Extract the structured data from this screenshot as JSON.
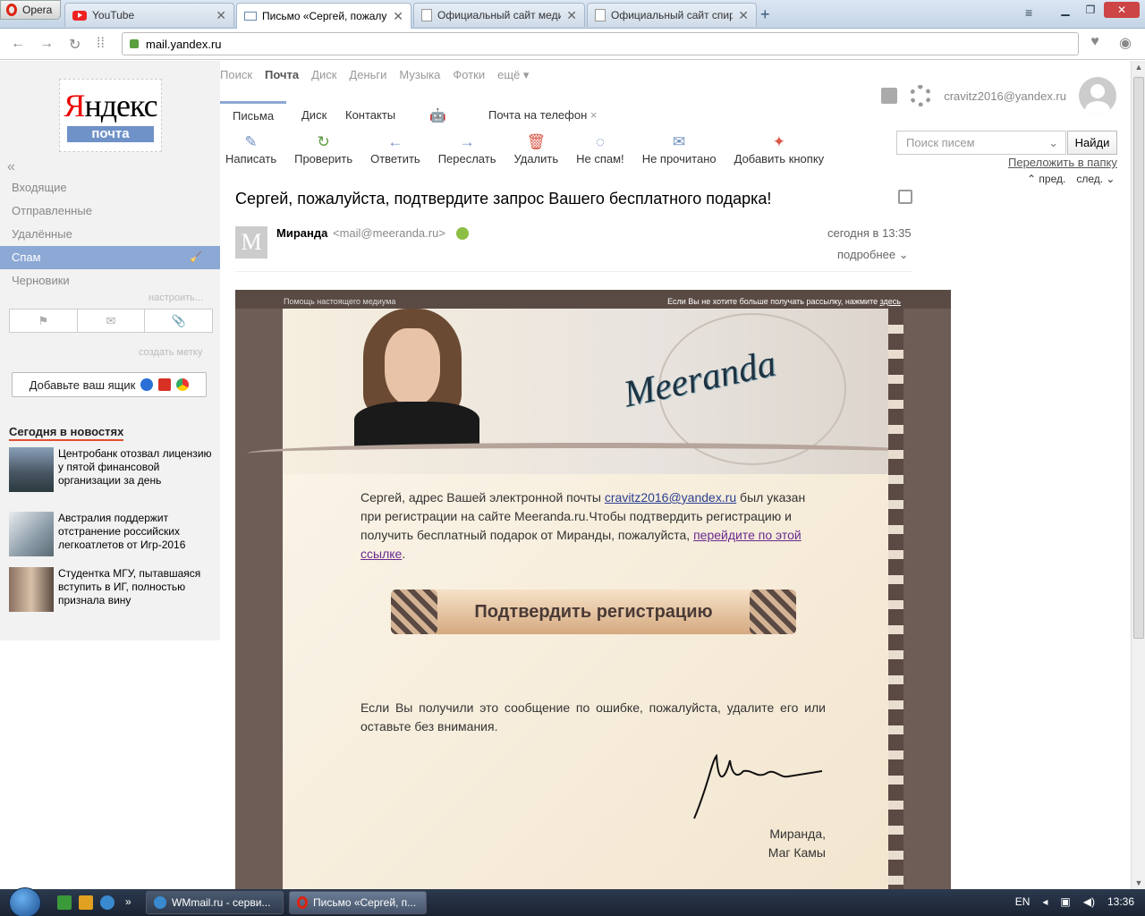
{
  "browser": {
    "menu_label": "Opera",
    "tabs": [
      {
        "title": "YouTube"
      },
      {
        "title": "Письмо «Сергей, пожалу"
      },
      {
        "title": "Официальный сайт меди"
      },
      {
        "title": "Официальный сайт спир"
      }
    ],
    "url_host": "mail.yandex.ru"
  },
  "sidebar": {
    "logo_text": "Яндекс",
    "logo_sub": "почта",
    "folders": [
      "Входящие",
      "Отправленные",
      "Удалённые",
      "Спам",
      "Черновики"
    ],
    "active_folder": "Спам",
    "configure_label": "настроить...",
    "create_label_link": "создать метку",
    "add_box_label": "Добавьте ваш ящик",
    "news_heading": "Сегодня в новостях",
    "news": [
      "Центробанк отозвал лицензию у пятой финансовой организации за день",
      "Австралия поддержит отстранение российских легкоатлетов от Игр-2016",
      "Студентка МГУ, пытавшаяся вступить в ИГ, полностью признала вину"
    ]
  },
  "services": [
    "Поиск",
    "Почта",
    "Диск",
    "Деньги",
    "Музыка",
    "Фотки",
    "ещё ▾"
  ],
  "user_email": "cravitz2016@yandex.ru",
  "mail_tabs": [
    "Письма",
    "Диск",
    "Контакты"
  ],
  "phone_link": "Почта на телефон",
  "toolbar": [
    {
      "label": "Написать",
      "icon": "compose-icon"
    },
    {
      "label": "Проверить",
      "icon": "refresh-icon"
    },
    {
      "label": "Ответить",
      "icon": "reply-icon"
    },
    {
      "label": "Переслать",
      "icon": "forward-icon"
    },
    {
      "label": "Удалить",
      "icon": "trash-icon"
    },
    {
      "label": "Не спам!",
      "icon": "not-spam-icon"
    },
    {
      "label": "Не прочитано",
      "icon": "envelope-icon"
    },
    {
      "label": "Добавить кнопку",
      "icon": "add-button-icon"
    }
  ],
  "search": {
    "placeholder": "Поиск писем",
    "button": "Найди"
  },
  "move_link": "Переложить в папку",
  "nav": {
    "prev": "пред.",
    "next": "след."
  },
  "message": {
    "subject": "Сергей, пожалуйста, подтвердите запрос Вашего бесплатного подарка!",
    "sender_initial": "M",
    "sender_name": "Миранда",
    "sender_email": "<mail@meeranda.ru>",
    "date": "сегодня в 13:35",
    "more": "подробнее"
  },
  "letter": {
    "top_left": "Помощь настоящего медиума",
    "top_right_prefix": "Если Вы не хотите больше получать рассылку, нажмите",
    "top_right_link": "здесь",
    "brand": "Meeranda",
    "p1_a": "Сергей, адрес Вашей электронной почты ",
    "p1_email": "cravitz2016@yandex.ru",
    "p1_b": " был указан при регистрации на сайте Meeranda.ru.Чтобы подтвердить регистрацию и получить бесплатный подарок от Миранды, пожалуйста, ",
    "p1_link": "перейдите по этой ссылке",
    "p1_c": ".",
    "cta": "Подтвердить регистрацию",
    "p2": "Если Вы получили это сообщение по ошибке, пожалуйста, удалите его или оставьте без внимания.",
    "sign_line1": "Миранда,",
    "sign_line2": "Маг Камы"
  },
  "taskbar": {
    "tasks": [
      "WMmail.ru - серви...",
      "Письмо «Сергей, п..."
    ],
    "lang": "EN",
    "time": "13:36"
  }
}
